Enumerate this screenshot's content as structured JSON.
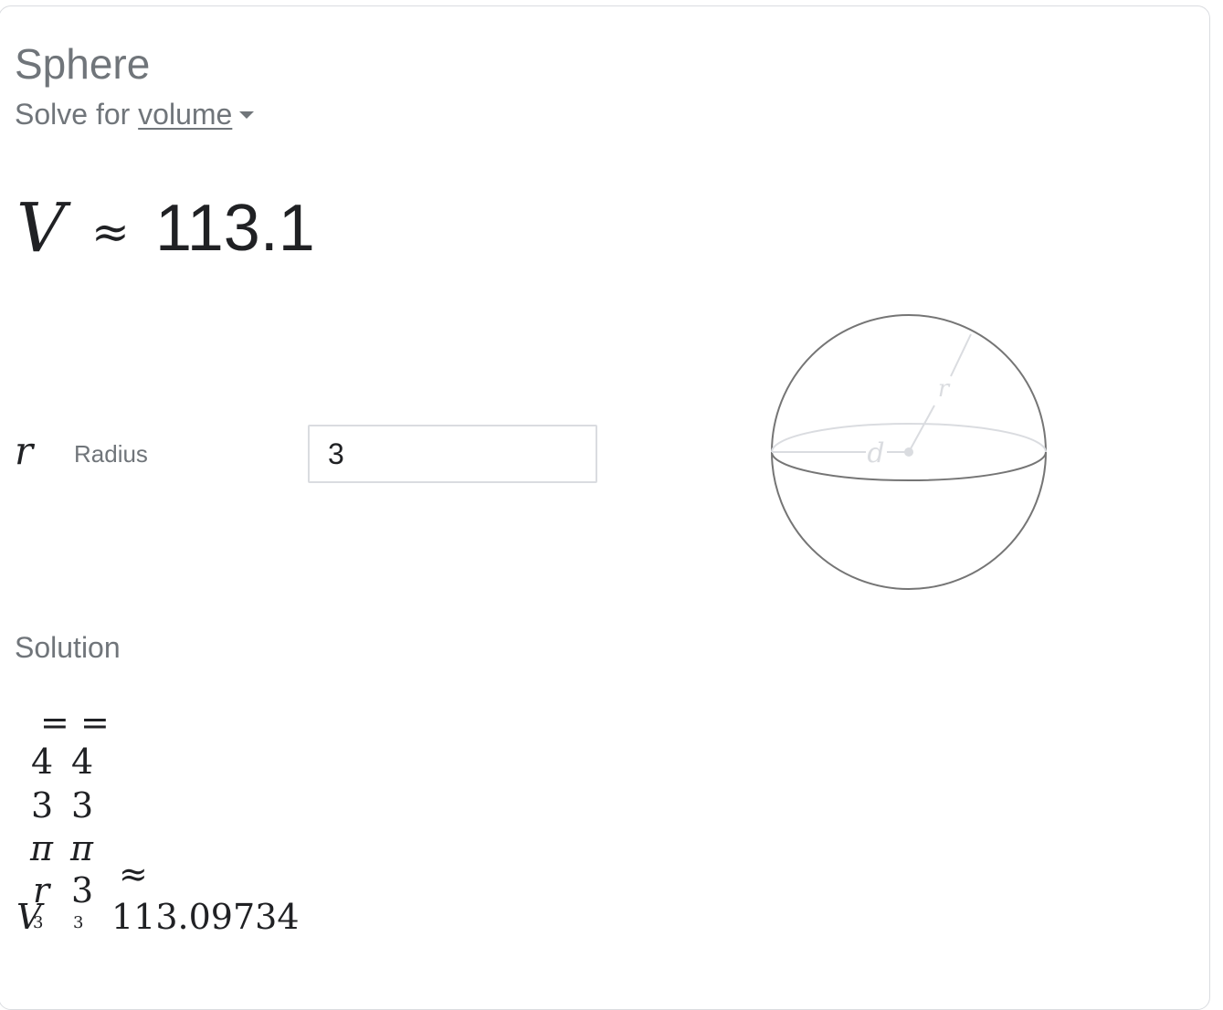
{
  "header": {
    "title": "Sphere",
    "solve_prefix": "Solve for",
    "solve_target": "volume"
  },
  "result": {
    "variable": "V",
    "relation": "≈",
    "value": "113.1"
  },
  "inputs": {
    "radius": {
      "symbol": "r",
      "label": "Radius",
      "value": "3"
    }
  },
  "diagram": {
    "radius_label": "r",
    "diameter_label": "d",
    "stroke_color": "#757575",
    "light_color": "#dadce0"
  },
  "solution": {
    "heading": "Solution",
    "equals": "=",
    "four": "4",
    "three": "3",
    "pi": "π",
    "r_symbol": "r",
    "r_value": "3",
    "exponent": "3",
    "V": "V",
    "approx": "≈",
    "result": "113.09734"
  }
}
